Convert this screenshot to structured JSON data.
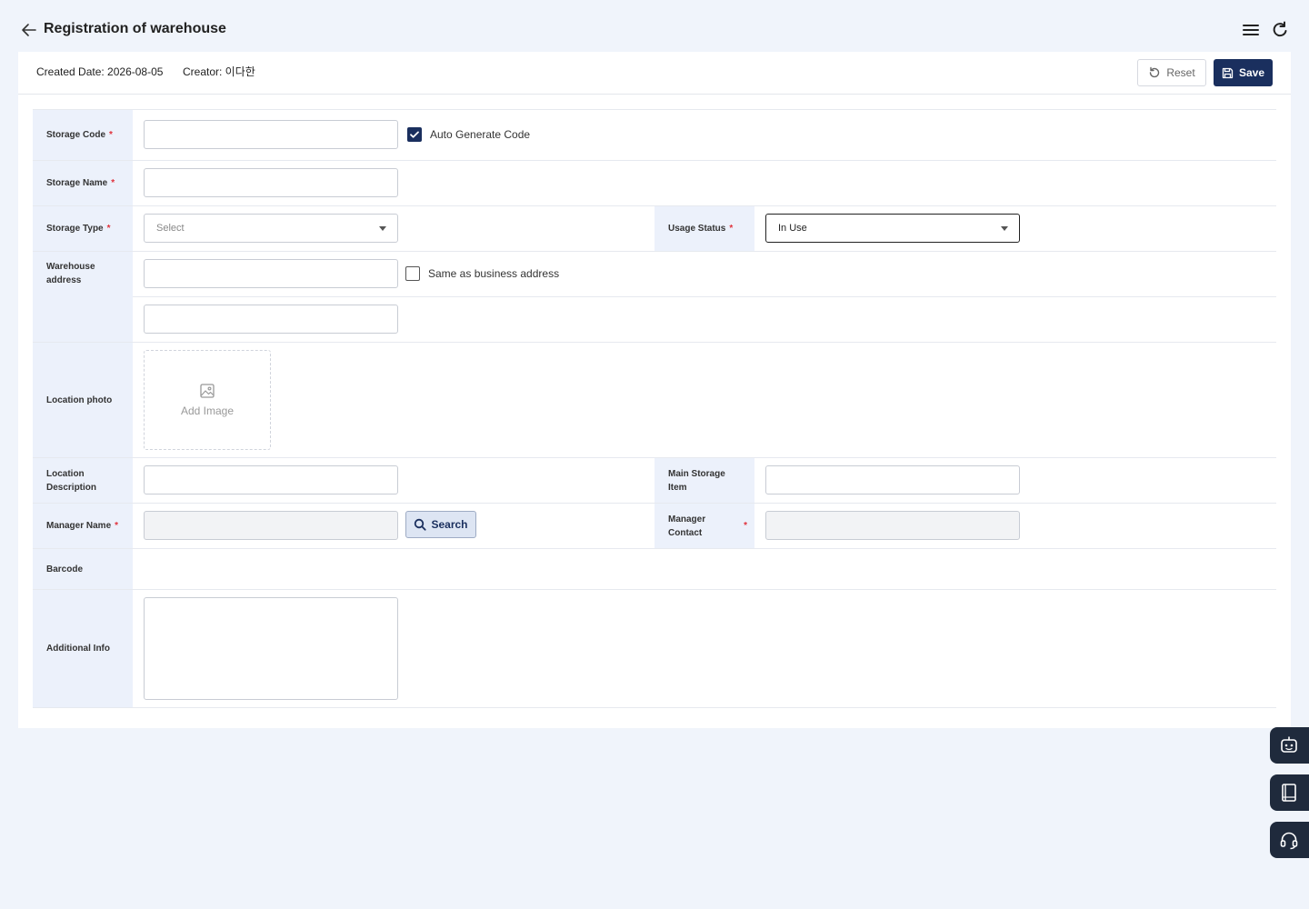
{
  "header": {
    "title": "Registration of warehouse"
  },
  "meta": {
    "created": "Created Date: 2026-08-05",
    "creator": "Creator: 이다한"
  },
  "actions": {
    "reset": "Reset",
    "save": "Save"
  },
  "form": {
    "storage_code": {
      "label": "Storage Code",
      "value": "",
      "auto_generate": "Auto Generate Code",
      "auto_checked": true
    },
    "storage_name": {
      "label": "Storage Name",
      "value": ""
    },
    "storage_type": {
      "label": "Storage Type",
      "placeholder": "Select"
    },
    "usage_status": {
      "label": "Usage Status",
      "value": "In Use"
    },
    "warehouse_address": {
      "label_line1": "Warehouse",
      "label_line2": "address",
      "same_as": "Same as business address",
      "same_checked": false
    },
    "location_photo": {
      "label": "Location photo",
      "add_image": "Add Image"
    },
    "location_description": {
      "label_line1": "Location",
      "label_line2": "Description"
    },
    "main_storage_item": {
      "label": "Main Storage Item"
    },
    "manager_name": {
      "label": "Manager Name",
      "search": "Search"
    },
    "manager_contact": {
      "label_line1": "Manager",
      "label_line2": "Contact"
    },
    "barcode": {
      "label": "Barcode"
    },
    "additional_info": {
      "label": "Additional Info"
    }
  },
  "colors": {
    "primary": "#1a2f5e",
    "label_bg": "#ecf1fb",
    "required": "#e0323c",
    "page_bg": "#f0f4fb"
  }
}
